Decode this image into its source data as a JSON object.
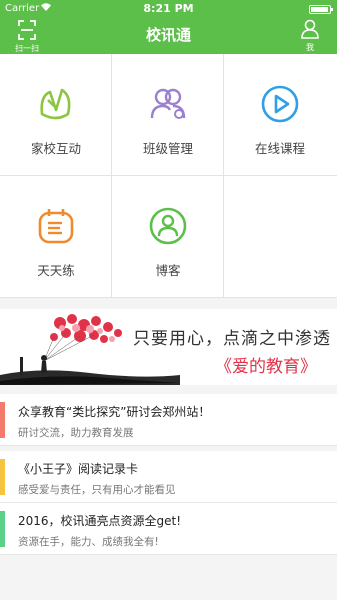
{
  "status": {
    "carrier": "Carrier",
    "time": "8:21 PM"
  },
  "nav": {
    "scan_label": "扫一扫",
    "title": "校讯通",
    "me_label": "我"
  },
  "colors": {
    "brand": "#5cbf49",
    "accent_red": "#e0334a"
  },
  "grid": [
    {
      "label": "家校互动",
      "icon": "home-school-icon",
      "color": "#8cc63f"
    },
    {
      "label": "班级管理",
      "icon": "class-manage-icon",
      "color": "#9b7fd1"
    },
    {
      "label": "在线课程",
      "icon": "play-icon",
      "color": "#2f9fe6"
    },
    {
      "label": "天天练",
      "icon": "practice-icon",
      "color": "#f08a2c"
    },
    {
      "label": "博客",
      "icon": "blog-icon",
      "color": "#5cbf49"
    }
  ],
  "banner": {
    "line1": "只要用心，点滴之中渗透",
    "line2": "《爱的教育》"
  },
  "news": [
    {
      "title": "众享教育“类比探究”研讨会郑州站！",
      "sub": "研讨交流，助力教育发展",
      "bar_color": "#f47a6b"
    },
    {
      "title": "《小王子》阅读记录卡",
      "sub": "感受爱与责任，只有用心才能看见",
      "bar_color": "#f5c542"
    },
    {
      "title": "2016，校讯通亮点资源全get!",
      "sub": "资源在手，能力、成绩我全有!",
      "bar_color": "#5cd087"
    }
  ]
}
